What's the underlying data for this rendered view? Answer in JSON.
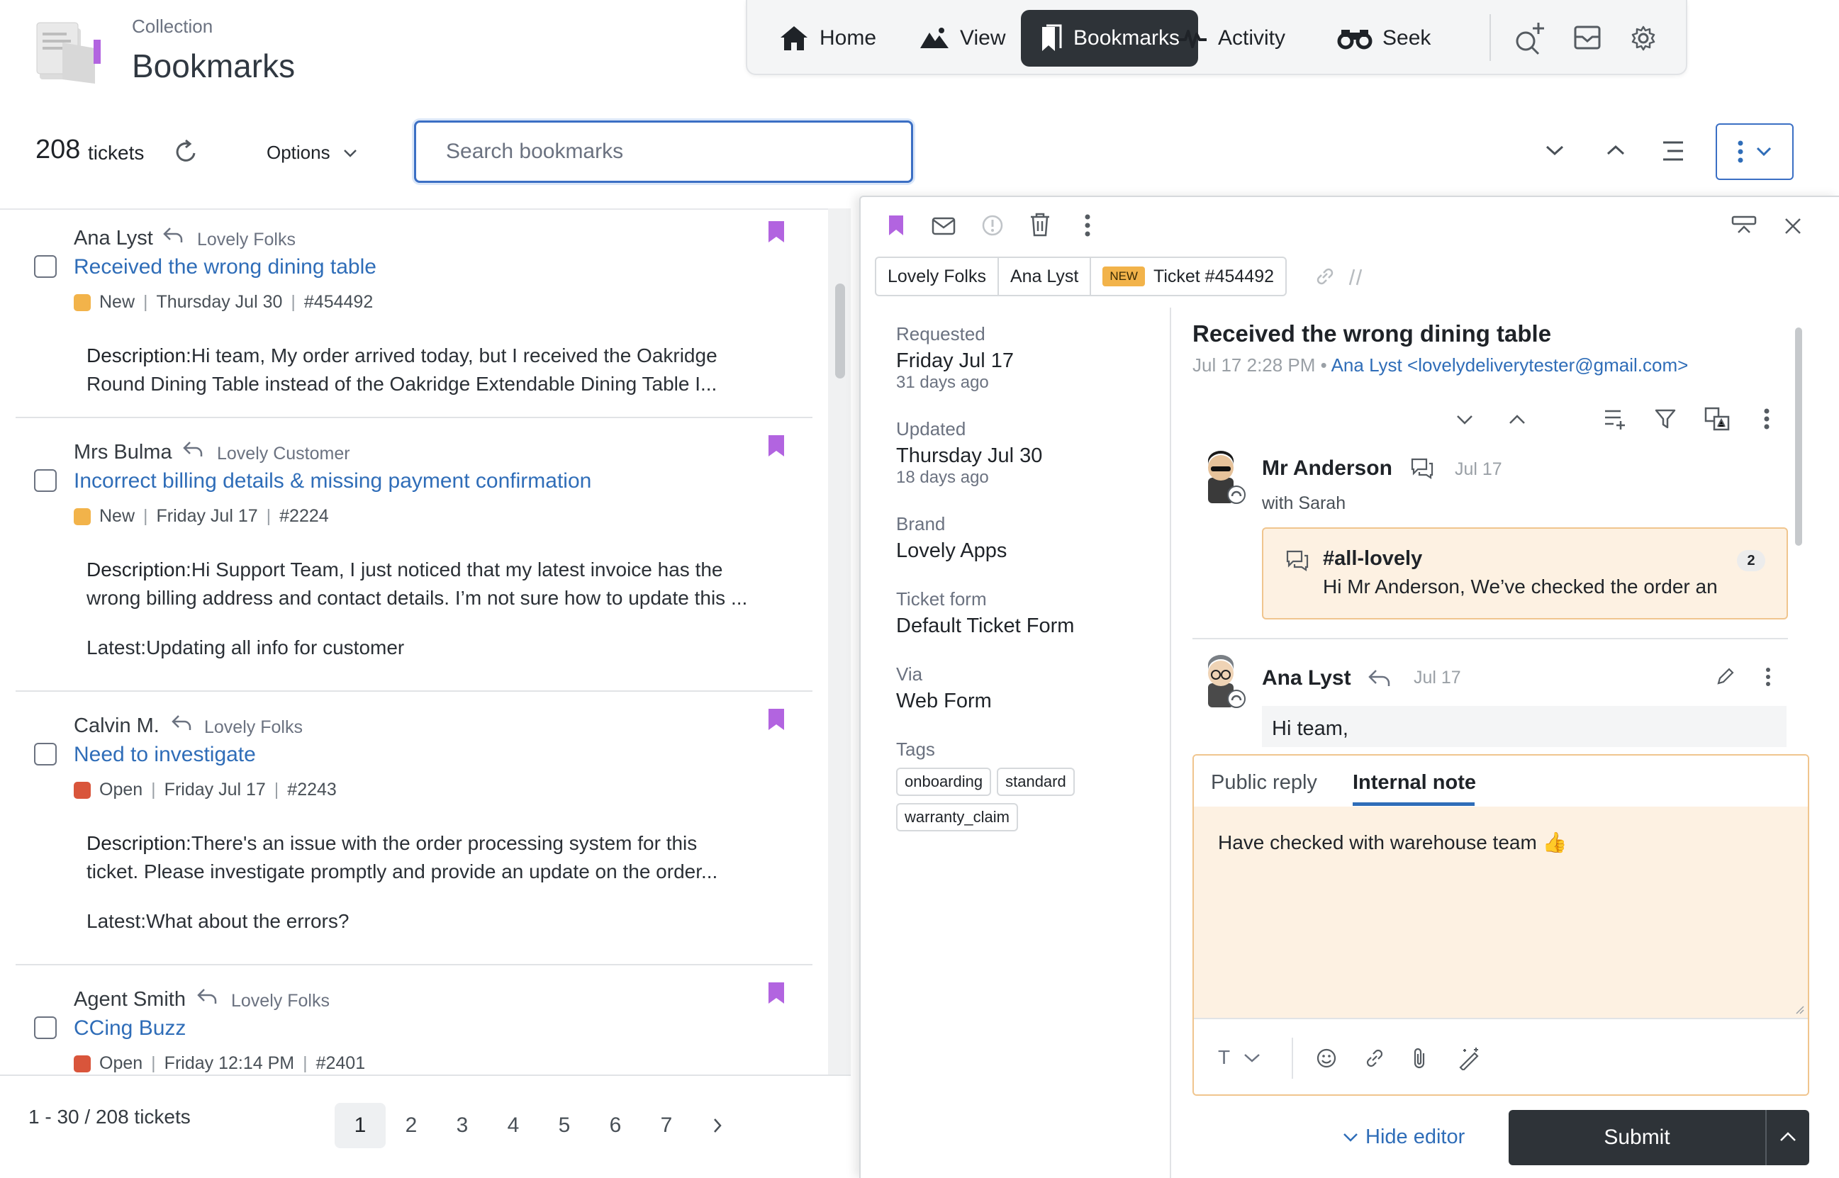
{
  "header": {
    "subtitle": "Collection",
    "title": "Bookmarks"
  },
  "nav": {
    "items": [
      {
        "label": "Home",
        "icon": "home-icon"
      },
      {
        "label": "View",
        "icon": "mountain-icon"
      },
      {
        "label": "Bookmarks",
        "icon": "bookmarks-icon",
        "active": true
      },
      {
        "label": "Activity",
        "icon": "activity-icon"
      },
      {
        "label": "Seek",
        "icon": "binoculars-icon"
      }
    ],
    "tools": [
      "search-plus-icon",
      "inbox-icon",
      "gear-icon"
    ]
  },
  "toolbar": {
    "count": "208",
    "count_label": "tickets",
    "options_label": "Options",
    "search_placeholder": "Search bookmarks"
  },
  "tickets": [
    {
      "author": "Ana Lyst",
      "group": "Lovely Folks",
      "title": "Received the wrong dining table",
      "status": "New",
      "date": "Thursday Jul 30",
      "id": "#454492",
      "desc_label": "Description:",
      "desc_line1": "Hi team, My order arrived today, but I received the Oakridge",
      "desc_line2": "Round Dining Table instead of the Oakridge Extendable Dining Table I...",
      "latest_label": "",
      "latest": ""
    },
    {
      "author": "Mrs Bulma",
      "group": "Lovely Customer",
      "title": "Incorrect billing details & missing payment confirmation",
      "status": "New",
      "date": "Friday Jul 17",
      "id": "#2224",
      "desc_label": "Description:",
      "desc_line1": "Hi Support Team, I just noticed that my latest invoice has the",
      "desc_line2": "wrong billing address and contact details. I’m not sure how to update this ...",
      "latest_label": "Latest:",
      "latest": "Updating all info for customer"
    },
    {
      "author": "Calvin M.",
      "group": "Lovely Folks",
      "title": "Need to investigate",
      "status": "Open",
      "date": "Friday Jul 17",
      "id": "#2243",
      "desc_label": "Description:",
      "desc_line1": "There's an issue with the order processing system for this",
      "desc_line2": "ticket. Please investigate promptly and provide an update on the order...",
      "latest_label": "Latest:",
      "latest": "What about the errors?"
    },
    {
      "author": "Agent Smith",
      "group": "Lovely Folks",
      "title": "CCing Buzz",
      "status": "Open",
      "date": "Friday 12:14 PM",
      "id": "#2401",
      "desc_label": "",
      "desc_line1": "",
      "desc_line2": "",
      "latest_label": "",
      "latest": ""
    }
  ],
  "status_colors": {
    "New": "#f2b34a",
    "Open": "#d9553b"
  },
  "accent": "#2f6db8",
  "bookmark_color": "#b264e0",
  "footer": {
    "range": "1 - 30 / 208 tickets",
    "pages": [
      "1",
      "2",
      "3",
      "4",
      "5",
      "6",
      "7"
    ],
    "current_page": "1"
  },
  "detail": {
    "crumbs": {
      "org": "Lovely Folks",
      "requester": "Ana Lyst",
      "badge": "NEW",
      "ticket": "Ticket #454492"
    },
    "props": {
      "requested_label": "Requested",
      "requested": "Friday Jul 17",
      "requested_ago": "31 days ago",
      "updated_label": "Updated",
      "updated": "Thursday Jul 30",
      "updated_ago": "18 days ago",
      "brand_label": "Brand",
      "brand": "Lovely Apps",
      "form_label": "Ticket form",
      "form": "Default Ticket Form",
      "via_label": "Via",
      "via": "Web Form",
      "tags_label": "Tags",
      "tags": [
        "onboarding",
        "standard",
        "warranty_claim"
      ]
    },
    "conversation": {
      "title": "Received the wrong dining table",
      "time": "Jul 17 2:28 PM",
      "sep": "•",
      "from": "Ana Lyst <lovelydeliverytester@gmail.com>",
      "messages": [
        {
          "name": "Mr Anderson",
          "date": "Jul 17",
          "with": "with Sarah"
        },
        {
          "name": "Ana Lyst",
          "date": "Jul 17",
          "body": "Hi team,"
        }
      ],
      "side_conversation": {
        "channel": "#all-lovely",
        "text": "Hi Mr Anderson, We’ve checked the order an",
        "count": "2"
      }
    },
    "editor": {
      "tab_public": "Public reply",
      "tab_internal": "Internal note",
      "text": "Have checked with warehouse team 👍",
      "format_label": "T"
    },
    "hide_editor": "Hide editor",
    "submit": "Submit"
  }
}
